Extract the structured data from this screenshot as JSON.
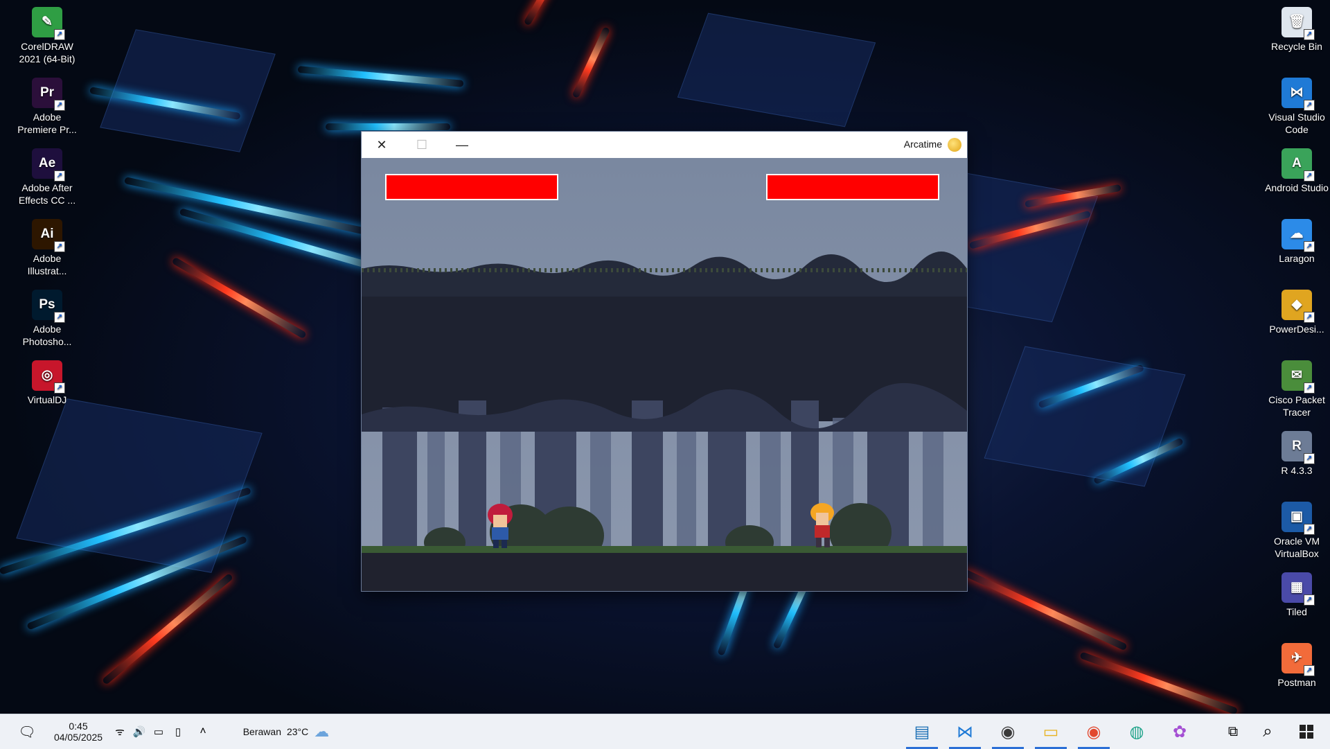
{
  "window": {
    "title": "Arcatime",
    "close_symbol": "✕",
    "maximize_symbol": "☐",
    "minimize_symbol": "—"
  },
  "game": {
    "player_left_hp": 1.0,
    "player_right_hp": 1.0,
    "hp_color": "#ff0000"
  },
  "desktop_left": [
    {
      "label": "CorelDRAW 2021 (64-Bit)",
      "icon": "coreldraw-icon",
      "glyph": "✎",
      "color": "#2f9e44"
    },
    {
      "label": "Adobe Premiere Pr...",
      "icon": "premiere-icon",
      "glyph": "Pr",
      "color": "#2b0f3a"
    },
    {
      "label": "Adobe After Effects CC ...",
      "icon": "after-effects-icon",
      "glyph": "Ae",
      "color": "#1e0f3d"
    },
    {
      "label": "Adobe Illustrat...",
      "icon": "illustrator-icon",
      "glyph": "Ai",
      "color": "#2d1600"
    },
    {
      "label": "Adobe Photosho...",
      "icon": "photoshop-icon",
      "glyph": "Ps",
      "color": "#001a2e"
    },
    {
      "label": "VirtualDJ",
      "icon": "virtualdj-icon",
      "glyph": "◎",
      "color": "#c7162b"
    }
  ],
  "desktop_right": [
    {
      "label": "Recycle Bin",
      "icon": "recycle-bin-icon",
      "glyph": "🗑",
      "color": "#dfe6ee"
    },
    {
      "label": "Visual Studio Code",
      "icon": "vscode-icon",
      "glyph": "⋈",
      "color": "#1f7ad6"
    },
    {
      "label": "Android Studio",
      "icon": "android-studio-icon",
      "glyph": "A",
      "color": "#3aa35a"
    },
    {
      "label": "Laragon",
      "icon": "laragon-icon",
      "glyph": "☁",
      "color": "#2c8be8"
    },
    {
      "label": "PowerDesi...",
      "icon": "powerdesigner-icon",
      "glyph": "◆",
      "color": "#e0a520"
    },
    {
      "label": "Cisco Packet Tracer",
      "icon": "cisco-packet-tracer-icon",
      "glyph": "✉",
      "color": "#4a8d3b"
    },
    {
      "label": "R 4.3.3",
      "icon": "r-language-icon",
      "glyph": "R",
      "color": "#6d7c96"
    },
    {
      "label": "Oracle VM VirtualBox",
      "icon": "virtualbox-icon",
      "glyph": "▣",
      "color": "#1c5aa6"
    },
    {
      "label": "Tiled",
      "icon": "tiled-icon",
      "glyph": "▦",
      "color": "#4a4aa8"
    },
    {
      "label": "Postman",
      "icon": "postman-icon",
      "glyph": "✈",
      "color": "#f26b3a"
    }
  ],
  "taskbar": {
    "time": "0:45",
    "date": "04/05/2025",
    "weather_temp": "23°C",
    "weather_text": "Berawan",
    "apps": [
      {
        "name": "screen-capture-app",
        "glyph": "▤",
        "color": "#1a6fb5"
      },
      {
        "name": "vscode-taskbar",
        "glyph": "⋈",
        "color": "#1f7ad6"
      },
      {
        "name": "chrome-dev-taskbar",
        "glyph": "◉",
        "color": "#3a3a3a"
      },
      {
        "name": "file-explorer-taskbar",
        "glyph": "▭",
        "color": "#e8b21f"
      },
      {
        "name": "chrome-taskbar",
        "glyph": "◉",
        "color": "#e2482f"
      },
      {
        "name": "edge-taskbar",
        "glyph": "◍",
        "color": "#1fa38a"
      },
      {
        "name": "copilot-taskbar",
        "glyph": "✿",
        "color": "#a44fd3"
      }
    ]
  }
}
